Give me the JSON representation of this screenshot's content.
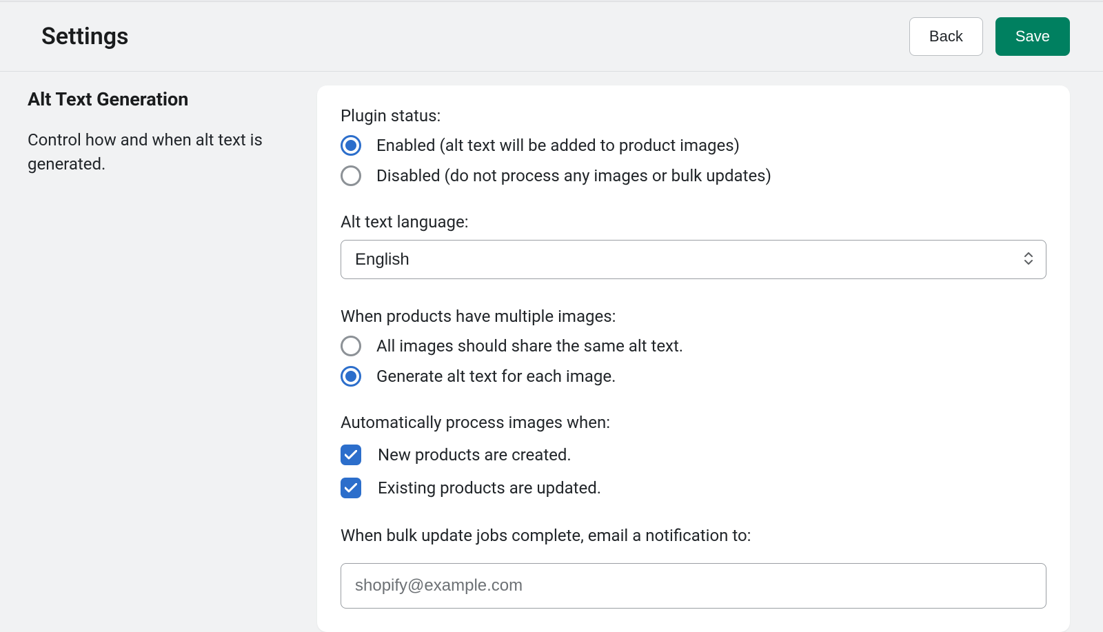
{
  "header": {
    "title": "Settings",
    "back_label": "Back",
    "save_label": "Save"
  },
  "sidebar": {
    "heading": "Alt Text Generation",
    "description": "Control how and when alt text is generated."
  },
  "form": {
    "plugin_status": {
      "label": "Plugin status:",
      "options": {
        "enabled": "Enabled (alt text will be added to product images)",
        "disabled": "Disabled (do not process any images or bulk updates)"
      },
      "selected": "enabled"
    },
    "language": {
      "label": "Alt text language:",
      "value": "English"
    },
    "multiple_images": {
      "label": "When products have multiple images:",
      "options": {
        "share": "All images should share the same alt text.",
        "each": "Generate alt text for each image."
      },
      "selected": "each"
    },
    "auto_process": {
      "label": "Automatically process images when:",
      "options": {
        "new_products": {
          "label": "New products are created.",
          "checked": true
        },
        "updated_products": {
          "label": "Existing products are updated.",
          "checked": true
        }
      }
    },
    "notification": {
      "label": "When bulk update jobs complete, email a notification to:",
      "value": "shopify@example.com"
    }
  }
}
